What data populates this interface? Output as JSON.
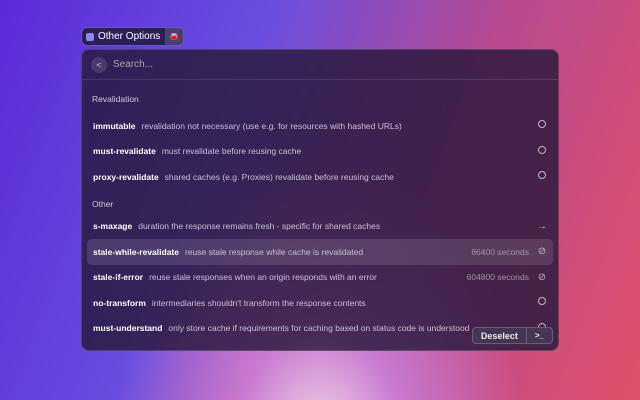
{
  "chip": {
    "label": "Other Options",
    "icon": "app-icon",
    "secondary_icon": "car-icon"
  },
  "search": {
    "placeholder": "Search..."
  },
  "sections": [
    {
      "title": "Revalidation",
      "items": [
        {
          "name": "immutable",
          "desc": "revalidation not necessary (use e.g. for resources with hashed URLs)",
          "value": "",
          "icon": "circle"
        },
        {
          "name": "must-revalidate",
          "desc": "must revalidate before reusing cache",
          "value": "",
          "icon": "circle"
        },
        {
          "name": "proxy-revalidate",
          "desc": "shared caches (e.g. Proxies) revalidate before reusing cache",
          "value": "",
          "icon": "circle"
        }
      ]
    },
    {
      "title": "Other",
      "items": [
        {
          "name": "s-maxage",
          "desc": "duration the response remains fresh - specific for shared caches",
          "value": "",
          "icon": "arrow"
        },
        {
          "name": "stale-while-revalidate",
          "desc": "reuse stale response while cache is revalidated",
          "value": "86400 seconds",
          "icon": "check-circle",
          "selected": true
        },
        {
          "name": "stale-if-error",
          "desc": "reuse stale responses when an origin responds with an error",
          "value": "604800 seconds",
          "icon": "check-circle"
        },
        {
          "name": "no-transform",
          "desc": "intermediaries shouldn't transform the response contents",
          "value": "",
          "icon": "circle"
        },
        {
          "name": "must-understand",
          "desc": "only store cache if requirements for caching based on status code is understood",
          "value": "",
          "icon": "circle"
        }
      ]
    }
  ],
  "footer": {
    "deselect": "Deselect",
    "terminal": ">_"
  }
}
